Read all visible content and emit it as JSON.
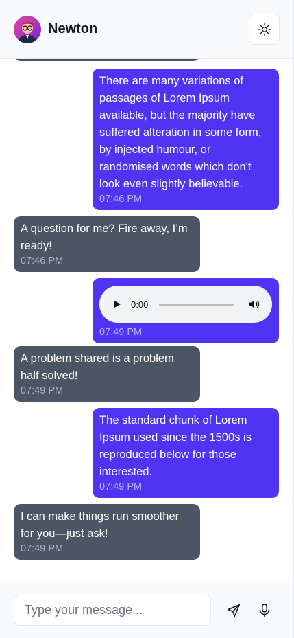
{
  "header": {
    "title": "Newton",
    "theme_toggle_icon": "sun-icon",
    "avatar_icon": "avatar"
  },
  "messages": [
    {
      "from": "user",
      "text": "There are many variations of passages of Lorem Ipsum available, but the majority have suffered alteration in some form, by injected humour, or randomised words which don't look even slightly believable.",
      "time": "07:46 PM"
    },
    {
      "from": "bot",
      "text": "A question for me? Fire away, I’m ready!",
      "time": "07:46 PM"
    },
    {
      "from": "user",
      "audio": {
        "current": "0:00",
        "progress": 0
      },
      "time": "07:49 PM"
    },
    {
      "from": "bot",
      "text": "A problem shared is a problem half solved!",
      "time": "07:49 PM"
    },
    {
      "from": "user",
      "text": "The standard chunk of Lorem Ipsum used since the 1500s is reproduced below for those interested.",
      "time": "07:49 PM"
    },
    {
      "from": "bot",
      "text": "I can make things run smoother for you—just ask!",
      "time": "07:49 PM"
    }
  ],
  "composer": {
    "placeholder": "Type your message...",
    "send_icon": "send-icon",
    "mic_icon": "microphone-icon"
  },
  "colors": {
    "user_bubble": "#4f35f3",
    "bot_bubble": "#4b5563"
  }
}
